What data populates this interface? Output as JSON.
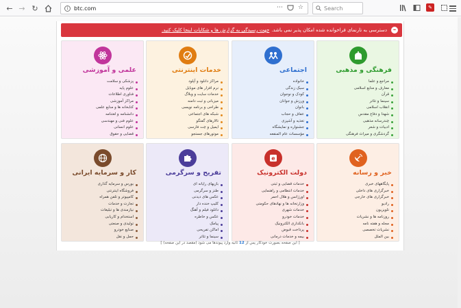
{
  "browser": {
    "url": "btc.com",
    "search_placeholder": "Search",
    "reader_icon": "reader-view-icon",
    "more_icon": "page-actions-icon"
  },
  "notice": {
    "text": "دسترسی به تارنمای فراخوانده شده امکان پذیر نمی باشد.",
    "link": "جهت رسیدگی به گزارش ها و شکایات اینجا کلیک کنید."
  },
  "cards": [
    {
      "title": "فرهنگی و مذهبی",
      "icon": "mosque-icon",
      "bg": "#eaf7e3",
      "color": "#2e9b2e",
      "dot": "#3aa33a",
      "items": [
        "مراجع و علما",
        "معارف و منابع اسلامی",
        "قرآن",
        "سینما و تئاتر",
        "انقلاب اسلامی",
        "شهدا و دفاع مقدس",
        "چندرسانه مذهبی",
        "ادبیات و شعر",
        "گردشگری و میراث فرهنگی"
      ]
    },
    {
      "title": "اجتماعی",
      "icon": "people-icon",
      "bg": "#e6eefb",
      "color": "#2f6fcf",
      "dot": "#2f6fcf",
      "items": [
        "خانواده",
        "سبک زندگی",
        "کودک و نوجوان",
        "ورزش و جوانان",
        "بانوان",
        "عفاف و حجاب",
        "تغذیه و آشپزی",
        "جشنواره و نمایشگاه",
        "مؤسسات عام المنفعه"
      ]
    },
    {
      "title": "خدمات اینترنتی",
      "icon": "cloud-service-icon",
      "bg": "#fdf2e0",
      "color": "#e07d12",
      "dot": "#e38a1e",
      "items": [
        "مراکز دانلود و آپلود",
        "نرم افزار های موبایل",
        "خدمات سایت و وبلاگ",
        "میزبانی و ثبت دامنه",
        "طراحی و برنامه نویسی",
        "شبکه های اجتماعی",
        "تالارهای گفتگو",
        "ایمیل و چت فارسی",
        "موتورهای جستجو"
      ]
    },
    {
      "title": "علمی و آموزشی",
      "icon": "atom-icon",
      "bg": "#fbe8f4",
      "color": "#c1359b",
      "dot": "#c1359b",
      "items": [
        "پزشکی و سلامت",
        "علوم پایه",
        "فناوری اطلاعات",
        "مراکز آموزشی",
        "کتابخانه ها و منابع علمی",
        "دانشنامه و لغتنامه",
        "علوم فنی و مهندسی",
        "علوم انسانی",
        "قضایی و حقوق"
      ]
    },
    {
      "title": "خبر و رسانه",
      "icon": "satellite-dish-icon",
      "bg": "#fdeee4",
      "color": "#e0621f",
      "dot": "#e0621f",
      "items": [
        "پایگاههای خبری",
        "خبرگزاری های داخلی",
        "خبرگزاری های خارجی",
        "رادیو",
        "تلویزیون",
        "روزنامه ها و نشریات",
        "مجله و هفته نامه",
        "نشریات تخصصی",
        "بین الملل"
      ]
    },
    {
      "title": "دولت الکترونیک",
      "icon": "government-icon",
      "bg": "#fde9e7",
      "color": "#c8302b",
      "dot": "#c8302b",
      "items": [
        "خدمات قضایی و ثبتی",
        "خدمات انتظامی و راهنمایی",
        "اورژانس و هلال احمر",
        "وزارتخانه ها و نهادهای حکومتی",
        "خدمات شهری",
        "خدمات خودرو",
        "بانکداری الکترونیک",
        "پرداخت قبوض",
        "بیمه و خدمات درمانی"
      ]
    },
    {
      "title": "تفریح و سرگرمی",
      "icon": "puzzle-icon",
      "bg": "#ece9f8",
      "color": "#4b3d9a",
      "dot": "#4b3d9a",
      "items": [
        "بازیهای رایانه ای",
        "طنز و سرگرمی",
        "عکس های دیدنی",
        "کلیپ خنده دار",
        "دانلود فیلم و آهنگ",
        "عکس و خاطره",
        "پیامک",
        "اماکن تفریحی",
        "سینما و تئاتر"
      ]
    },
    {
      "title": "کار و سرمایه ایرانی",
      "icon": "briefcase-globe-icon",
      "bg": "#f3e6dc",
      "color": "#7a4b2c",
      "dot": "#8a5a3a",
      "items": [
        "بورس و سرمایه گذاری",
        "فروشگاه اینترنتی",
        "کامپیوتر و تلفن همراه",
        "تجارت و خدمات",
        "نیازمندی ها و تبلیغات",
        "استخدام و کاریابی",
        "تولیدی و صنعتی",
        "صنایع خودرو",
        "حمل و نقل"
      ]
    }
  ],
  "footer": {
    "prefix": "[ این صفحه بصورت خودکار پس از",
    "seconds": "12",
    "suffix": "ثانیه وارد پیوندها می شود (مقصد در این صفحه) ]"
  }
}
